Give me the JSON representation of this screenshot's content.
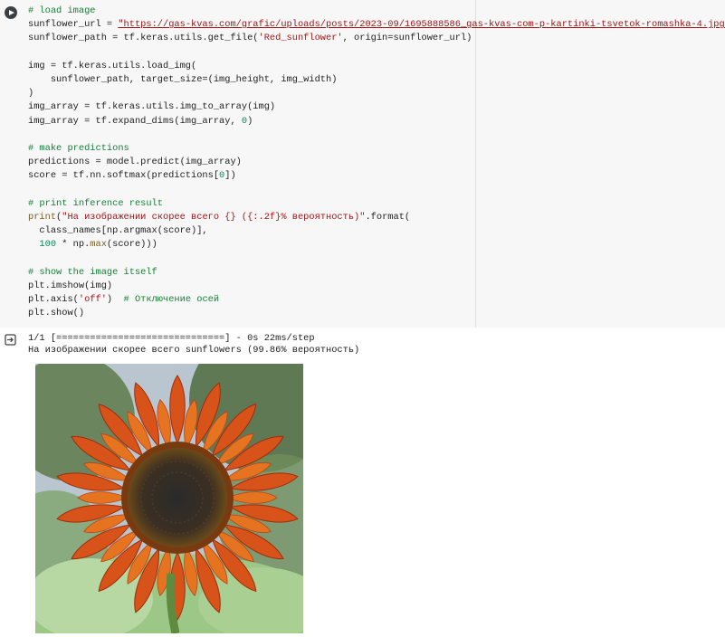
{
  "code_cell": {
    "run_button_icon": "play-icon",
    "lines": [
      {
        "comment": "# load image"
      },
      {
        "pre": "sunflower_url = ",
        "str": "\"https://gas-kvas.com/grafic/uploads/posts/2023-09/1695888586_gas-kvas-com-p-kartinki-tsvetok-romashka-4.jpg\""
      },
      {
        "pre": "sunflower_path = tf.keras.utils.get_file(",
        "str": "'Red_sunflower'",
        "post": ", origin=sunflower_url)"
      },
      {
        "blank": ""
      },
      {
        "pre": "img = tf.keras.utils.load_img("
      },
      {
        "pre": "    sunflower_path, target_size=(img_height, img_width)"
      },
      {
        "pre": ")"
      },
      {
        "pre": "img_array = tf.keras.utils.img_to_array(img)"
      },
      {
        "pre": "img_array = tf.expand_dims(img_array, ",
        "num": "0",
        "post": ")"
      },
      {
        "blank": ""
      },
      {
        "comment": "# make predictions"
      },
      {
        "pre": "predictions = model.predict(img_array)"
      },
      {
        "pre": "score = tf.nn.softmax(predictions[",
        "num": "0",
        "post": "])"
      },
      {
        "blank": ""
      },
      {
        "comment": "# print inference result"
      },
      {
        "fn": "print",
        "pre": "(",
        "str": "\"На изображении скорее всего {} ({:.2f}% вероятность)\"",
        "post": ".format("
      },
      {
        "pre": "  class_names[np.argmax(score)],"
      },
      {
        "pre": "  ",
        "num": "100",
        "post": " * np.",
        "fn2": "max",
        "post2": "(score)))"
      },
      {
        "blank": ""
      },
      {
        "comment": "# show the image itself"
      },
      {
        "pre": "plt.imshow(img)"
      },
      {
        "pre": "plt.axis(",
        "str": "'off'",
        "post": ")  ",
        "comment_tail": "# Отключение осей"
      },
      {
        "pre": "plt.show()"
      }
    ]
  },
  "output": {
    "icon": "output-redirect-icon",
    "progress_line": "1/1 [==============================] - 0s 22ms/step",
    "result_line": "На изображении скорее всего sunflowers (99.86% вероятность)",
    "image_label": "sunflower-image"
  }
}
